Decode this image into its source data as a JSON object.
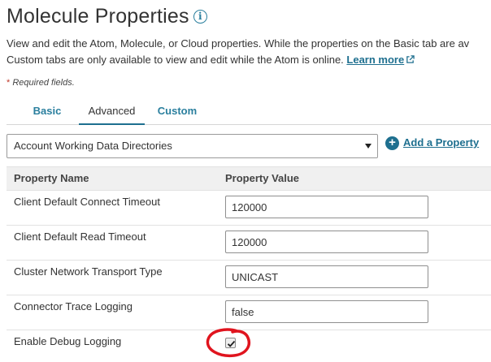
{
  "header": {
    "title": "Molecule Properties",
    "info_icon": "info-icon"
  },
  "description": {
    "line1": "View and edit the Atom, Molecule, or Cloud properties. While the properties on the Basic tab are av",
    "line2": "Custom tabs are only available to view and edit while the Atom is online.",
    "learn_more": "Learn more",
    "external_icon": "external-link-icon"
  },
  "required_note": {
    "star": "*",
    "text": "Required fields."
  },
  "tabs": [
    {
      "label": "Basic",
      "active": false
    },
    {
      "label": "Advanced",
      "active": true
    },
    {
      "label": "Custom",
      "active": false
    }
  ],
  "property_select": {
    "value": "Account Working Data Directories",
    "caret_icon": "caret-down-icon"
  },
  "add_property": {
    "icon": "plus-circle-icon",
    "label": "Add a Property"
  },
  "table": {
    "headers": [
      "Property Name",
      "Property Value"
    ],
    "rows": [
      {
        "name": "Client Default Connect Timeout",
        "value": "120000",
        "type": "text"
      },
      {
        "name": "Client Default Read Timeout",
        "value": "120000",
        "type": "text"
      },
      {
        "name": "Cluster Network Transport Type",
        "value": "UNICAST",
        "type": "text"
      },
      {
        "name": "Connector Trace Logging",
        "value": "false",
        "type": "text"
      },
      {
        "name": "Enable Debug Logging",
        "checked": true,
        "type": "checkbox"
      }
    ]
  },
  "colors": {
    "accent": "#1e6f8f",
    "tab_link": "#2a7f9e",
    "annotation": "#e0141e",
    "header_bg": "#f0f0f0"
  }
}
